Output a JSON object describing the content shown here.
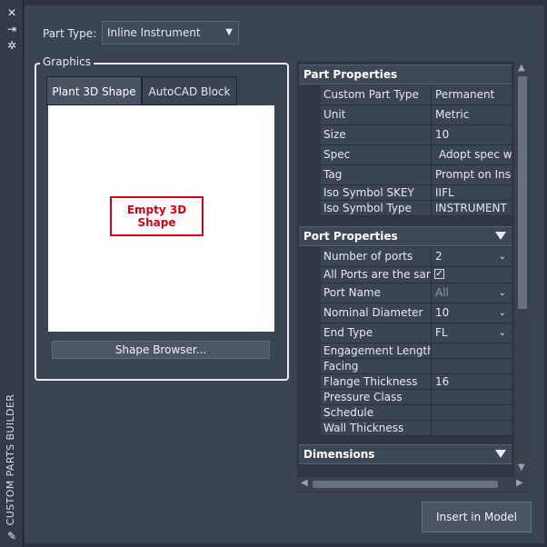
{
  "palette": {
    "title": "CUSTOM PARTS BUILDER",
    "icons": [
      "close-icon",
      "auto-hide-icon",
      "properties-icon",
      "edit-icon"
    ]
  },
  "part_type": {
    "label": "Part Type:",
    "value": "Inline Instrument"
  },
  "graphics": {
    "legend": "Graphics",
    "tabs": [
      "Plant 3D Shape",
      "AutoCAD Block"
    ],
    "empty_line1": "Empty 3D",
    "empty_line2": "Shape",
    "shape_browser": "Shape Browser..."
  },
  "part_properties": {
    "title": "Part Properties",
    "rows": [
      {
        "label": "Custom Part Type",
        "value": "Permanent"
      },
      {
        "label": "Unit",
        "value": "Metric"
      },
      {
        "label": "Size",
        "value": "10"
      },
      {
        "label": "Spec",
        "value": "Adopt spec whe"
      },
      {
        "label": "Tag",
        "value": "Prompt on Inser"
      },
      {
        "label": "Iso Symbol SKEY",
        "value": "IIFL"
      },
      {
        "label": "Iso Symbol Type",
        "value": "INSTRUMENT"
      }
    ]
  },
  "port_properties": {
    "title": "Port Properties",
    "rows": [
      {
        "label": "Number of ports",
        "value": "2"
      },
      {
        "label": "All Ports are the same",
        "value": "✓"
      },
      {
        "label": "Port Name",
        "value": "All"
      },
      {
        "label": "Nominal Diameter",
        "value": "10"
      },
      {
        "label": "End Type",
        "value": "FL"
      },
      {
        "label": "Engagement Length",
        "value": ""
      },
      {
        "label": "Facing",
        "value": ""
      },
      {
        "label": "Flange Thickness",
        "value": "16"
      },
      {
        "label": "Pressure Class",
        "value": ""
      },
      {
        "label": "Schedule",
        "value": ""
      },
      {
        "label": "Wall Thickness",
        "value": ""
      }
    ]
  },
  "dimensions": {
    "title": "Dimensions"
  },
  "insert_button": "Insert in Model"
}
